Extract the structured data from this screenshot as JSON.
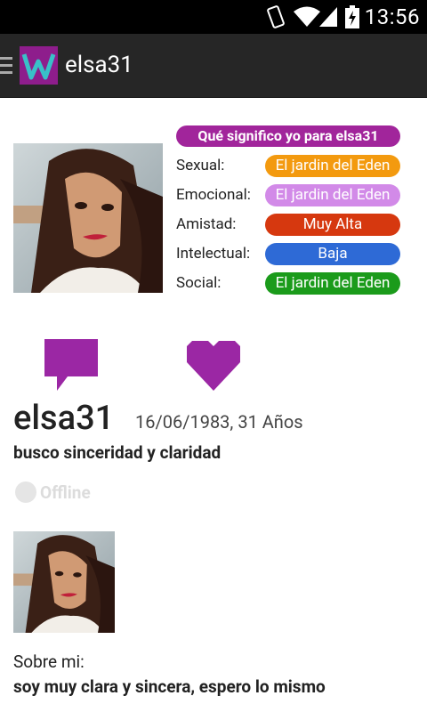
{
  "statusbar": {
    "time": "13:56"
  },
  "actionbar": {
    "title": "elsa31",
    "logo_letter": "W"
  },
  "relationship": {
    "header": "Qué significo yo para elsa31",
    "rows": [
      {
        "label": "Sexual:",
        "value": "El jardin del Eden",
        "color": "#f39a0f"
      },
      {
        "label": "Emocional:",
        "value": "El jardin del Eden",
        "color": "#d28ae8"
      },
      {
        "label": "Amistad:",
        "value": "Muy Alta",
        "color": "#d6380f"
      },
      {
        "label": "Intelectual:",
        "value": "Baja",
        "color": "#2e6ad6"
      },
      {
        "label": "Social:",
        "value": "El jardin del Eden",
        "color": "#1b9b1b"
      }
    ]
  },
  "profile": {
    "username": "elsa31",
    "birth": "16/06/1983, 31 Años",
    "tagline": "busco sinceridad y claridad",
    "status": "Offline",
    "about_label": "Sobre mi:",
    "about_text": "soy muy clara y sincera, espero lo mismo"
  },
  "icons": {
    "chat": "chat-bubble-icon",
    "heart": "heart-icon",
    "accent": "#9b27a4"
  }
}
